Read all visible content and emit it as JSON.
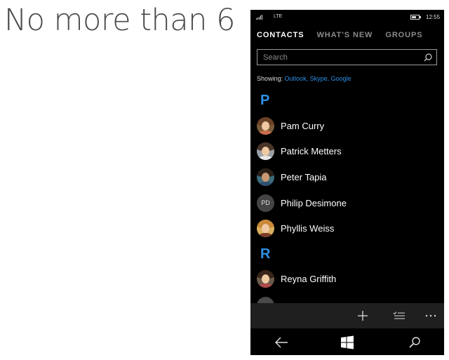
{
  "slide": {
    "heading": "No more than 6"
  },
  "status_bar": {
    "network": "LTE",
    "time": "12:55"
  },
  "tabs": [
    {
      "label": "CONTACTS",
      "active": true
    },
    {
      "label": "WHAT'S NEW",
      "active": false
    },
    {
      "label": "GROUPS",
      "active": false
    }
  ],
  "search": {
    "placeholder": "Search"
  },
  "showing": {
    "label": "Showing:",
    "accounts": "Outlook, Skype, Google"
  },
  "groups": [
    {
      "letter": "P",
      "contacts": [
        {
          "name": "Pam Curry",
          "avatar": "photo"
        },
        {
          "name": "Patrick Metters",
          "avatar": "photo"
        },
        {
          "name": "Peter Tapia",
          "avatar": "photo"
        },
        {
          "name": "Philip Desimone",
          "avatar": "initials",
          "initials": "PD"
        },
        {
          "name": "Phyllis Weiss",
          "avatar": "photo"
        }
      ]
    },
    {
      "letter": "R",
      "contacts": [
        {
          "name": "Reyna Griffith",
          "avatar": "photo"
        }
      ]
    }
  ],
  "app_bar": {
    "buttons": [
      "add-icon",
      "select-icon",
      "more-icon"
    ]
  },
  "nav_bar": {
    "buttons": [
      "back-icon",
      "windows-icon",
      "search-icon"
    ]
  },
  "colors": {
    "accent": "#2d8fe6",
    "background": "#000000",
    "app_bar": "#1f1f1f"
  }
}
